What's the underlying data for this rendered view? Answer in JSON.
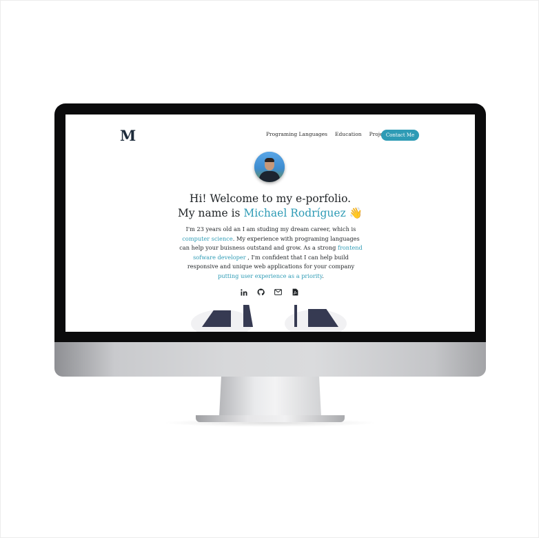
{
  "site": {
    "logo": "M",
    "nav": [
      "Programing Languages",
      "Education",
      "Projects"
    ],
    "contact_button": "Contact Me",
    "headline_line1": "Hi! Welcome to my e-porfolio.",
    "headline_prefix": "My name is ",
    "headline_name": "Michael Rodríguez",
    "wave_emoji": "👋",
    "bio": {
      "t1": "I'm 23 years old an I am studing my dream career, which is ",
      "link1": "computer science",
      "t2": ". My experience with programing languages can help your buisness outstand and grow. As a strong ",
      "link2": "frontend sofware developer",
      "t3": " , I'm confident that I can help build responsive and unique web applications for your company ",
      "link3": "putting user experience as a priority",
      "t4": "."
    },
    "social_icons": [
      "linkedin-icon",
      "github-icon",
      "mail-icon",
      "pdf-file-icon"
    ],
    "colors": {
      "accent": "#2e9bb5",
      "text": "#1f2326",
      "illustration": "#363a52"
    }
  }
}
